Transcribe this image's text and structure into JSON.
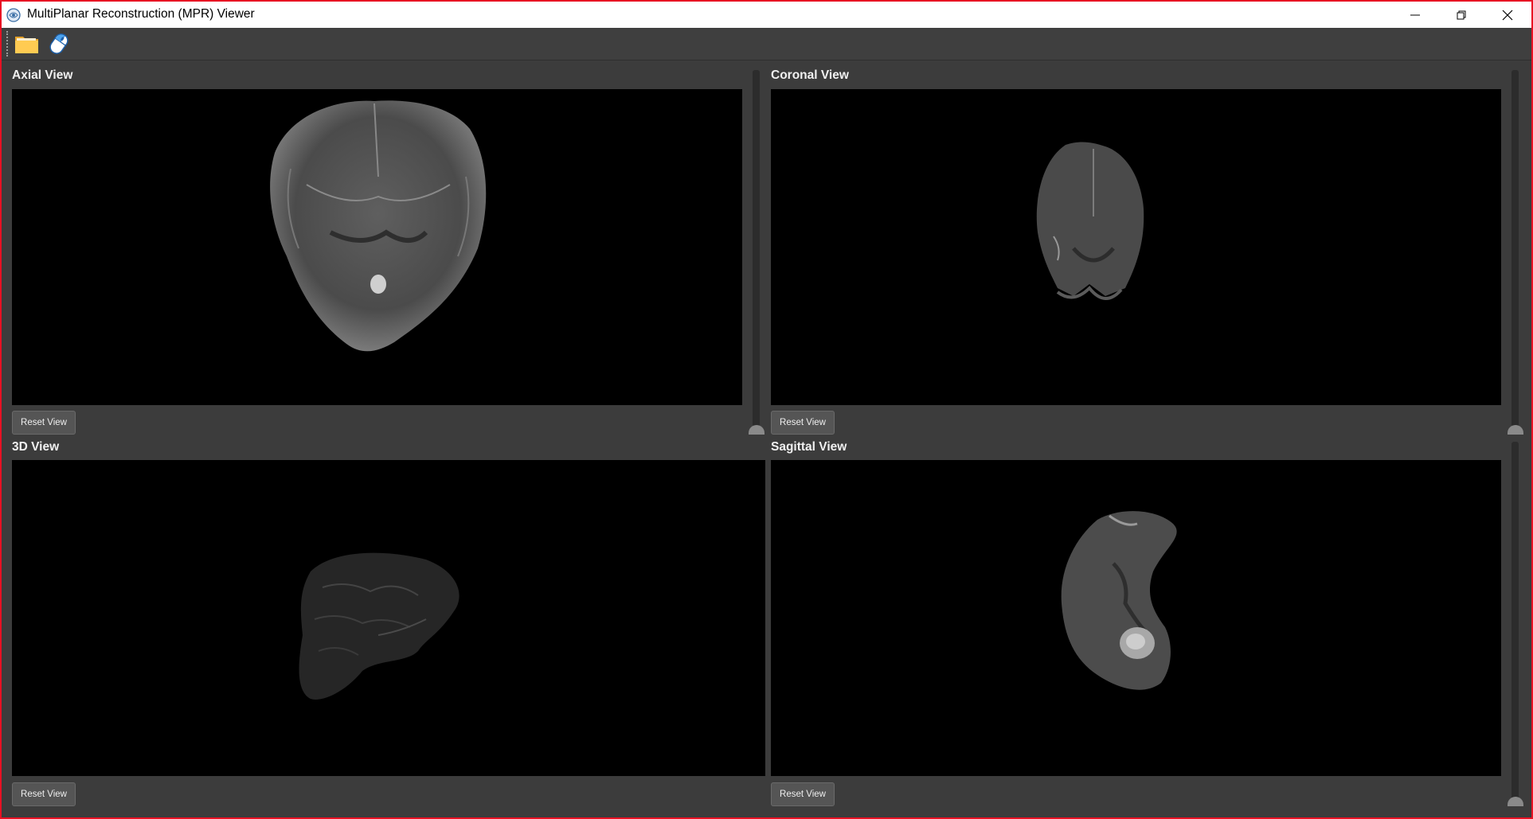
{
  "window": {
    "title": "MultiPlanar Reconstruction (MPR) Viewer",
    "controls": [
      "minimize-icon",
      "restore-icon",
      "close-icon"
    ],
    "frame_color": "#e81123"
  },
  "toolbar": {
    "items": [
      {
        "name": "open-folder",
        "icon": "folder-icon"
      },
      {
        "name": "mouse-interaction",
        "icon": "mouse-icon"
      }
    ]
  },
  "panels": {
    "axial": {
      "title": "Axial View",
      "reset_label": "Reset View",
      "slider_level": 0.0
    },
    "coronal": {
      "title": "Coronal View",
      "reset_label": "Reset View",
      "slider_level": 0.0
    },
    "view3d": {
      "title": "3D View",
      "reset_label": "Reset View"
    },
    "sagittal": {
      "title": "Sagittal View",
      "reset_label": "Reset View",
      "slider_level": 0.0
    }
  },
  "colors": {
    "background": "#3c3c3c",
    "viewport": "#000000",
    "button": "#555555",
    "text": "#f0f0f0"
  }
}
